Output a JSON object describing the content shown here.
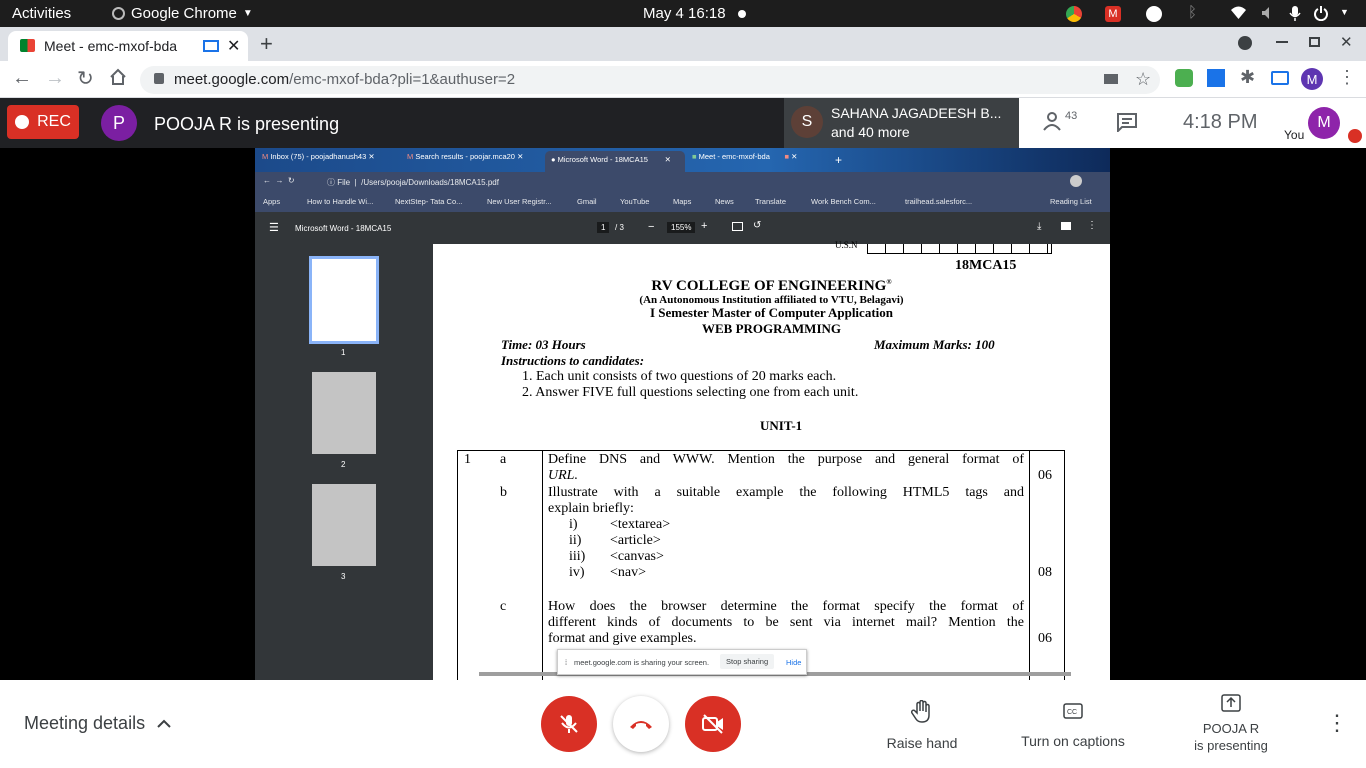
{
  "system": {
    "activities": "Activities",
    "app_menu": "Google Chrome",
    "clock": "May 4  16:18"
  },
  "browser": {
    "tab_title": "Meet - emc-mxof-bda",
    "url_host": "meet.google.com",
    "url_path": "/emc-mxof-bda?pli=1&authuser=2",
    "profile_initial": "M"
  },
  "meet": {
    "rec_label": "REC",
    "presenter_initial": "P",
    "presenting_text": "POOJA R is presenting",
    "participant_initial": "S",
    "participant_name": "SAHANA JAGADEESH B...",
    "participant_more": "and 40 more",
    "people_count": "43",
    "time": "4:18 PM",
    "you_label": "You",
    "you_initial": "M",
    "meeting_details": "Meeting details",
    "raise_hand": "Raise hand",
    "captions": "Turn on captions",
    "presenting_line1": "POOJA R",
    "presenting_line2": "is presenting"
  },
  "shared": {
    "tabs": [
      "Inbox (75) - poojadhanush43",
      "Search results - poojar.mca20",
      "Microsoft Word - 18MCA15",
      "Meet - emc-mxof-bda"
    ],
    "url_prefix": "File",
    "url": "/Users/pooja/Downloads/18MCA15.pdf",
    "bookmarks": [
      "Apps",
      "How to Handle Wi...",
      "NextStep- Tata Co...",
      "New User Registr...",
      "Gmail",
      "YouTube",
      "Maps",
      "News",
      "Translate",
      "Work Bench Com...",
      "trailhead.salesforc..."
    ],
    "reading_list": "Reading List",
    "pdf_title": "Microsoft Word - 18MCA15",
    "page_current": "1",
    "page_total": "/ 3",
    "zoom": "155%",
    "thumbs": [
      "1",
      "2",
      "3"
    ],
    "share_notice": "meet.google.com is sharing your screen.",
    "stop_sharing": "Stop sharing",
    "hide": "Hide"
  },
  "doc": {
    "code": "18MCA15",
    "usn": "U.S.N",
    "college": "RV COLLEGE OF ENGINEERING",
    "reg": "®",
    "autonomous": "(An Autonomous Institution affiliated to VTU, Belagavi)",
    "semester": "I Semester Master of Computer Application",
    "subject": "WEB PROGRAMMING",
    "time": "Time: 03 Hours",
    "marks": "Maximum Marks: 100",
    "instructions": "Instructions to candidates:",
    "inst1": "1.  Each unit consists of two questions of 20 marks each.",
    "inst2": "2.  Answer FIVE full questions selecting one from each unit.",
    "unit": "UNIT-1",
    "qnum": "1",
    "qa_letter": "a",
    "qa_l1": "Define DNS and WWW. Mention the purpose and general format of",
    "qa_l2": "URL.",
    "qa_marks": "06",
    "qb_letter": "b",
    "qb_l1": "Illustrate with a suitable example the following HTML5 tags and",
    "qb_l2": "explain briefly:",
    "qb_items": [
      [
        "i)",
        "<textarea>"
      ],
      [
        "ii)",
        "<article>"
      ],
      [
        "iii)",
        "<canvas>"
      ],
      [
        "iv)",
        "<nav>"
      ]
    ],
    "qb_marks": "08",
    "qc_letter": "c",
    "qc_l1": "How does the browser determine the format specify the format of",
    "qc_l2": "different kinds of documents to be sent via internet mail? Mention the",
    "qc_l3": "format and give examples.",
    "qc_marks": "06"
  }
}
